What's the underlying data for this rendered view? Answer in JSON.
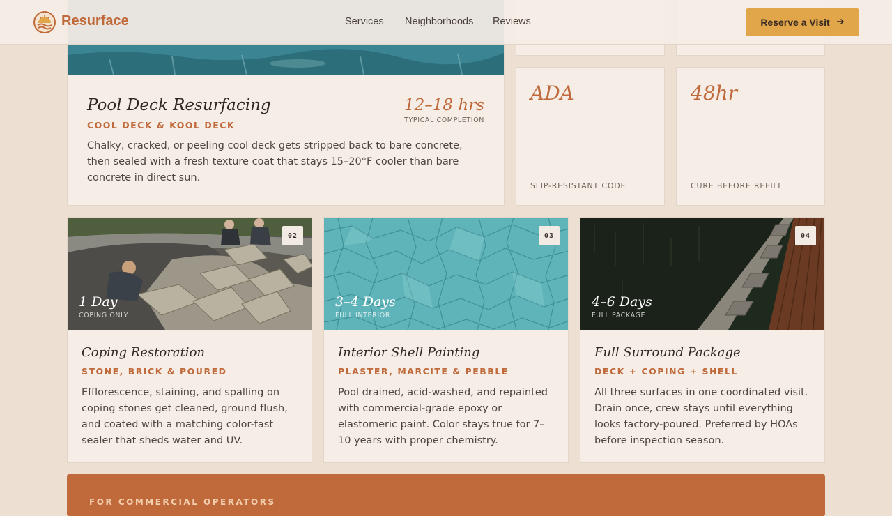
{
  "header": {
    "brand": "Resurface",
    "nav": [
      "Services",
      "Neighborhoods",
      "Reviews"
    ],
    "cta": "Reserve a Visit",
    "logo_icon": "sun-pool-logo-icon",
    "cta_icon": "arrow-right-icon"
  },
  "featured": {
    "title": "Pool Deck Resurfacing",
    "subtitle": "COOL DECK & KOOL DECK",
    "time": "12–18 hrs",
    "time_label": "TYPICAL COMPLETION",
    "description": "Chalky, cracked, or peeling cool deck gets stripped back to bare concrete, then sealed with a fresh texture coat that stays 15–20°F cooler than bare concrete in direct sun."
  },
  "stats": [
    {
      "value": "ADA",
      "label": "SLIP-RESISTANT CODE"
    },
    {
      "value": "48hr",
      "label": "CURE BEFORE REFILL"
    }
  ],
  "services": [
    {
      "badge": "02",
      "duration": "1 Day",
      "duration_label": "COPING ONLY",
      "title": "Coping Restoration",
      "subtitle": "STONE, BRICK & POURED",
      "description": "Efflorescence, staining, and spalling on coping stones get cleaned, ground flush, and coated with a matching color-fast sealer that sheds water and UV."
    },
    {
      "badge": "03",
      "duration": "3–4 Days",
      "duration_label": "FULL INTERIOR",
      "title": "Interior Shell Painting",
      "subtitle": "PLASTER, MARCITE & PEBBLE",
      "description": "Pool drained, acid-washed, and repainted with commercial-grade epoxy or elastomeric paint. Color stays true for 7–10 years with proper chemistry."
    },
    {
      "badge": "04",
      "duration": "4–6 Days",
      "duration_label": "FULL PACKAGE",
      "title": "Full Surround Package",
      "subtitle": "DECK + COPING + SHELL",
      "description": "All three surfaces in one coordinated visit. Drain once, crew stays until everything looks factory-poured. Preferred by HOAs before inspection season."
    }
  ],
  "banner": {
    "kicker": "FOR COMMERCIAL OPERATORS"
  },
  "colors": {
    "accent": "#c0693a",
    "cta": "#e2a64a",
    "background": "#ede0d2",
    "card": "#f5ede6"
  }
}
